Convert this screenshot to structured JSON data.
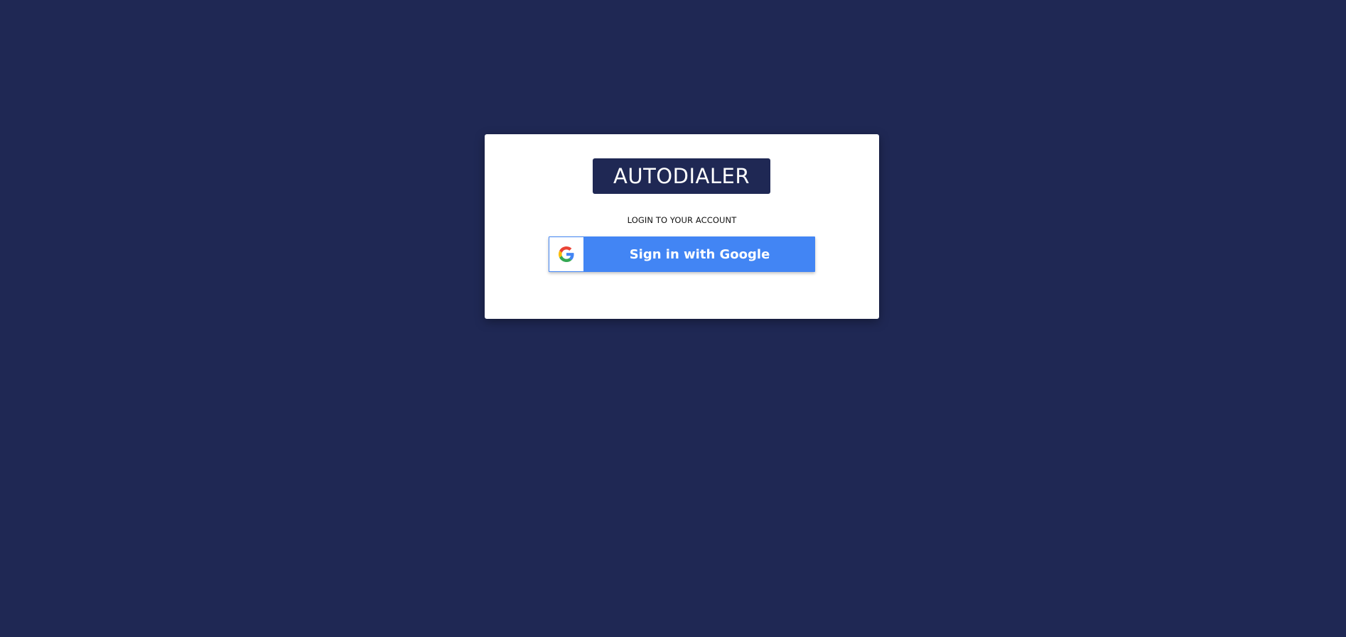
{
  "colors": {
    "background": "#1f2854",
    "card": "#ffffff",
    "google_blue": "#4285f4"
  },
  "login": {
    "logo_text": "AUTODIALER",
    "subtitle": "LOGIN TO YOUR ACCOUNT",
    "google_button": {
      "label": "Sign in with Google",
      "icon": "google-g-logo-icon"
    }
  }
}
